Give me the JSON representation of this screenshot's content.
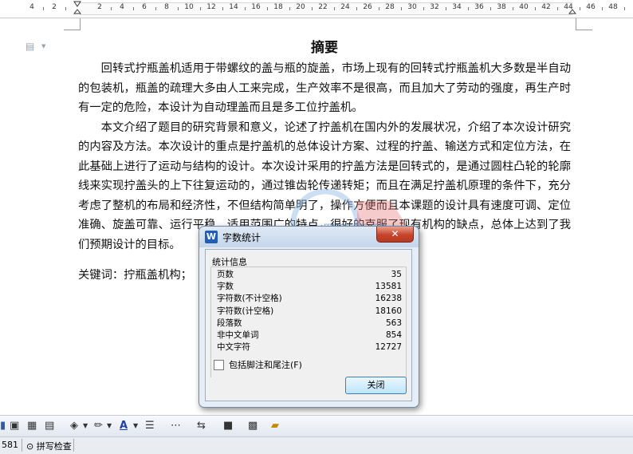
{
  "ruler": {
    "numbers": [
      "4",
      "2",
      "2",
      "4",
      "6",
      "8",
      "10",
      "12",
      "14",
      "16",
      "18",
      "20",
      "22",
      "24",
      "26",
      "28",
      "30",
      "32",
      "34",
      "36",
      "38",
      "40",
      "42",
      "44",
      "46",
      "48"
    ]
  },
  "document": {
    "title": "摘要",
    "paragraphs": [
      "回转式拧瓶盖机适用于带螺纹的盖与瓶的旋盖，市场上现有的回转式拧瓶盖机大多数是半自动的包装机，瓶盖的疏理大多由人工来完成，生产效率不是很高，而且加大了劳动的强度，再生产时有一定的危险，本设计为自动理盖而且是多工位拧盖机。",
      "本文介绍了题目的研究背景和意义，论述了拧盖机在国内外的发展状况，介绍了本次设计研究的内容及方法。本次设计的重点是拧盖机的总体设计方案、过程的拧盖、输送方式和定位方法，在此基础上进行了运动与结构的设计。本次设计采用的拧盖方法是回转式的，是通过圆柱凸轮的轮廓线来实现拧盖头的上下往复运动的，通过锥齿轮传递转矩；而且在满足拧盖机原理的条件下，充分考虑了整机的布局和经济性，不但结构简单明了，操作方便而且本课题的设计具有速度可调、定位准确、旋盖可靠、运行平稳、适用范围广的特点，很好的克服了现有机构的缺点，总体上达到了我们预期设计的目标。"
    ],
    "keywords": "关键词：拧瓶盖机构；"
  },
  "dialog": {
    "title": "字数统计",
    "close_x": "✕",
    "group_title": "统计信息",
    "stats": [
      {
        "label": "页数",
        "value": "35"
      },
      {
        "label": "字数",
        "value": "13581"
      },
      {
        "label": "字符数(不计空格)",
        "value": "16238"
      },
      {
        "label": "字符数(计空格)",
        "value": "18160"
      },
      {
        "label": "段落数",
        "value": "563"
      },
      {
        "label": "非中文单词",
        "value": "854"
      },
      {
        "label": "中文字符",
        "value": "12727"
      }
    ],
    "checkbox_label": "包括脚注和尾注(F)",
    "close_button": "关闭"
  },
  "watermark": {
    "text": "rrenrendoc.com"
  },
  "toolbar": {
    "icons": [
      "picture-icon",
      "insert-image-icon",
      "textbox-icon",
      "fill-color-icon",
      "line-color-icon",
      "font-color-icon",
      "line-style-icon",
      "dash-style-icon",
      "arrow-style-icon",
      "shadow-icon",
      "3d-icon",
      "select-objects-icon"
    ],
    "font_color_glyph": "A"
  },
  "status": {
    "count": "581",
    "spell": "拼写检查"
  },
  "colors": {
    "dialog_close": "#c7442b",
    "accent": "#1f5db8"
  }
}
